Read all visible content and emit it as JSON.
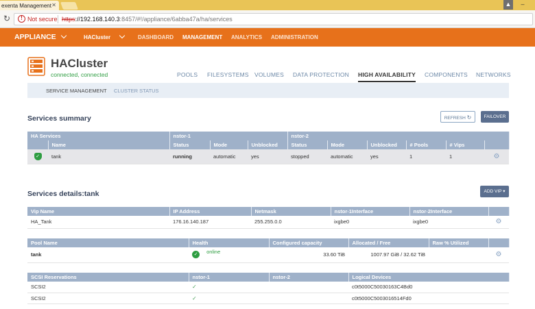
{
  "browser": {
    "tab_title": "exenta Management",
    "not_secure": "Not secure",
    "url_proto": "https",
    "url_host": "://192.168.140.3",
    "url_path": ":8457/#!/appliance/6abba47a/ha/services"
  },
  "topnav": {
    "brand": "APPLIANCE",
    "cluster": "HACluster",
    "items": [
      "DASHBOARD",
      "MANAGEMENT",
      "ANALYTICS",
      "ADMINISTRATION"
    ]
  },
  "cluster": {
    "name": "HACluster",
    "status": "connected, connected"
  },
  "tabs": [
    "POOLS",
    "FILESYSTEMS",
    "VOLUMES",
    "DATA PROTECTION",
    "HIGH AVAILABILITY",
    "COMPONENTS",
    "NETWORKS"
  ],
  "subtabs": [
    "SERVICE MANAGEMENT",
    "CLUSTER STATUS"
  ],
  "summary": {
    "title": "Services summary",
    "refresh": "REFRESH",
    "failover": "FAILOVER",
    "group_headers": [
      "HA Services",
      "nstor-1",
      "nstor-2"
    ],
    "headers": [
      "Name",
      "Status",
      "Mode",
      "Unblocked",
      "Status",
      "Mode",
      "Unblocked",
      "# Pools",
      "# Vips"
    ],
    "row": [
      "tank",
      "running",
      "automatic",
      "yes",
      "stopped",
      "automatic",
      "yes",
      "1",
      "1"
    ]
  },
  "details": {
    "title": "Services details:tank",
    "add_vip": "ADD VIP",
    "vip_headers": [
      "Vip Name",
      "IP Address",
      "Netmask",
      "nstor-1Interface",
      "nstor-2Interface"
    ],
    "vip_row": [
      "HA_Tank",
      "176.16.140.187",
      "255.255.0.0",
      "ixgbe0",
      "ixgbe0"
    ],
    "pool_headers": [
      "Pool Name",
      "Health",
      "Configured capacity",
      "Allocated / Free",
      "Raw % Utilized"
    ],
    "pool_row": [
      "tank",
      "online",
      "33.60 TiB",
      "1007.97 GiB / 32.62 TiB",
      ""
    ],
    "scsi_headers": [
      "SCSI Reservations",
      "nstor-1",
      "nstor-2",
      "Logical Devices"
    ],
    "scsi_rows": [
      [
        "SCSI2",
        "✓",
        "",
        "c0t5000C50030163C4Bd0"
      ],
      [
        "SCSI2",
        "✓",
        "",
        "c0t5000C5003016514Fd0"
      ]
    ]
  },
  "colors": {
    "accent": "#e7711b",
    "ok": "#2e9d41",
    "header": "#9fb1c9"
  }
}
